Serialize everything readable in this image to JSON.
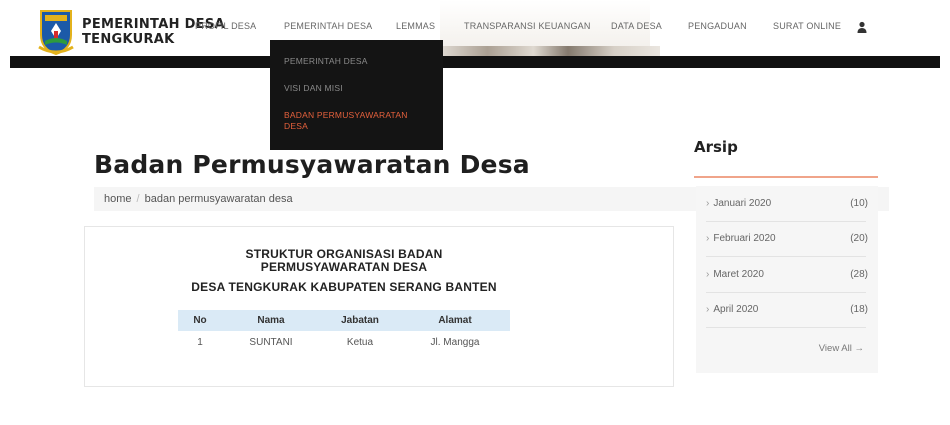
{
  "header": {
    "brand_line1": "PEMERINTAH DESA",
    "brand_line2": "TENGKURAK"
  },
  "nav": [
    {
      "label": "PROFIL DESA"
    },
    {
      "label": "PEMERINTAH DESA"
    },
    {
      "label": "LEMMAS"
    },
    {
      "label": "TRANSPARANSI KEUANGAN"
    },
    {
      "label": "DATA DESA"
    },
    {
      "label": "PENGADUAN"
    },
    {
      "label": "SURAT ONLINE"
    }
  ],
  "dropdown": {
    "items": [
      {
        "label": "PEMERINTAH DESA"
      },
      {
        "label": "VISI DAN MISI"
      },
      {
        "label": "BADAN PERMUSYAWARATAN DESA"
      }
    ],
    "active_color": "#e4603c"
  },
  "main": {
    "title": "Badan Permusyawaratan Desa",
    "breadcrumb": {
      "home": "home",
      "sep": "/",
      "current": "badan permusyawaratan desa"
    },
    "card": {
      "heading_line1": "STRUKTUR ORGANISASI BADAN",
      "heading_line2": "PERMUSYAWARATAN DESA",
      "subheading": "DESA TENGKURAK KABUPATEN SERANG BANTEN",
      "table": {
        "headers": [
          "No",
          "Nama",
          "Jabatan",
          "Alamat"
        ],
        "rows": [
          [
            "1",
            "SUNTANI",
            "Ketua",
            "Jl. Mangga"
          ]
        ]
      }
    }
  },
  "sidebar": {
    "title": "Arsip",
    "items": [
      {
        "label": "Januari 2020",
        "count": "(10)"
      },
      {
        "label": "Februari 2020",
        "count": "(20)"
      },
      {
        "label": "Maret 2020",
        "count": "(28)"
      },
      {
        "label": "April 2020",
        "count": "(18)"
      }
    ],
    "view_all": "View All →",
    "accent": "#f0a48a"
  }
}
